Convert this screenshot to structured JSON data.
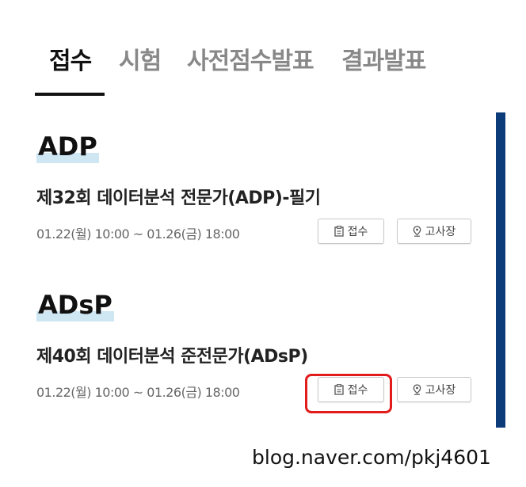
{
  "tabs": [
    {
      "label": "접수",
      "active": true
    },
    {
      "label": "시험",
      "active": false
    },
    {
      "label": "사전점수발표",
      "active": false
    },
    {
      "label": "결과발표",
      "active": false
    }
  ],
  "sections": [
    {
      "category": "ADP",
      "exam_name": "제32회 데이터분석 전문가(ADP)-필기",
      "period": "01.22(월) 10:00 ~ 01.26(금) 18:00",
      "apply_label": "접수",
      "venue_label": "고사장"
    },
    {
      "category": "ADsP",
      "exam_name": "제40회 데이터분석 준전문가(ADsP)",
      "period": "01.22(월) 10:00 ~ 01.26(금) 18:00",
      "apply_label": "접수",
      "venue_label": "고사장"
    }
  ],
  "watermark": "blog.naver.com/pkj4601",
  "colors": {
    "accent_bar": "#0d3c7a",
    "title_highlight": "#cfe6f3",
    "callout_box": "#e21b1b"
  },
  "icons": {
    "apply": "clipboard-icon",
    "venue": "map-pin-icon"
  }
}
